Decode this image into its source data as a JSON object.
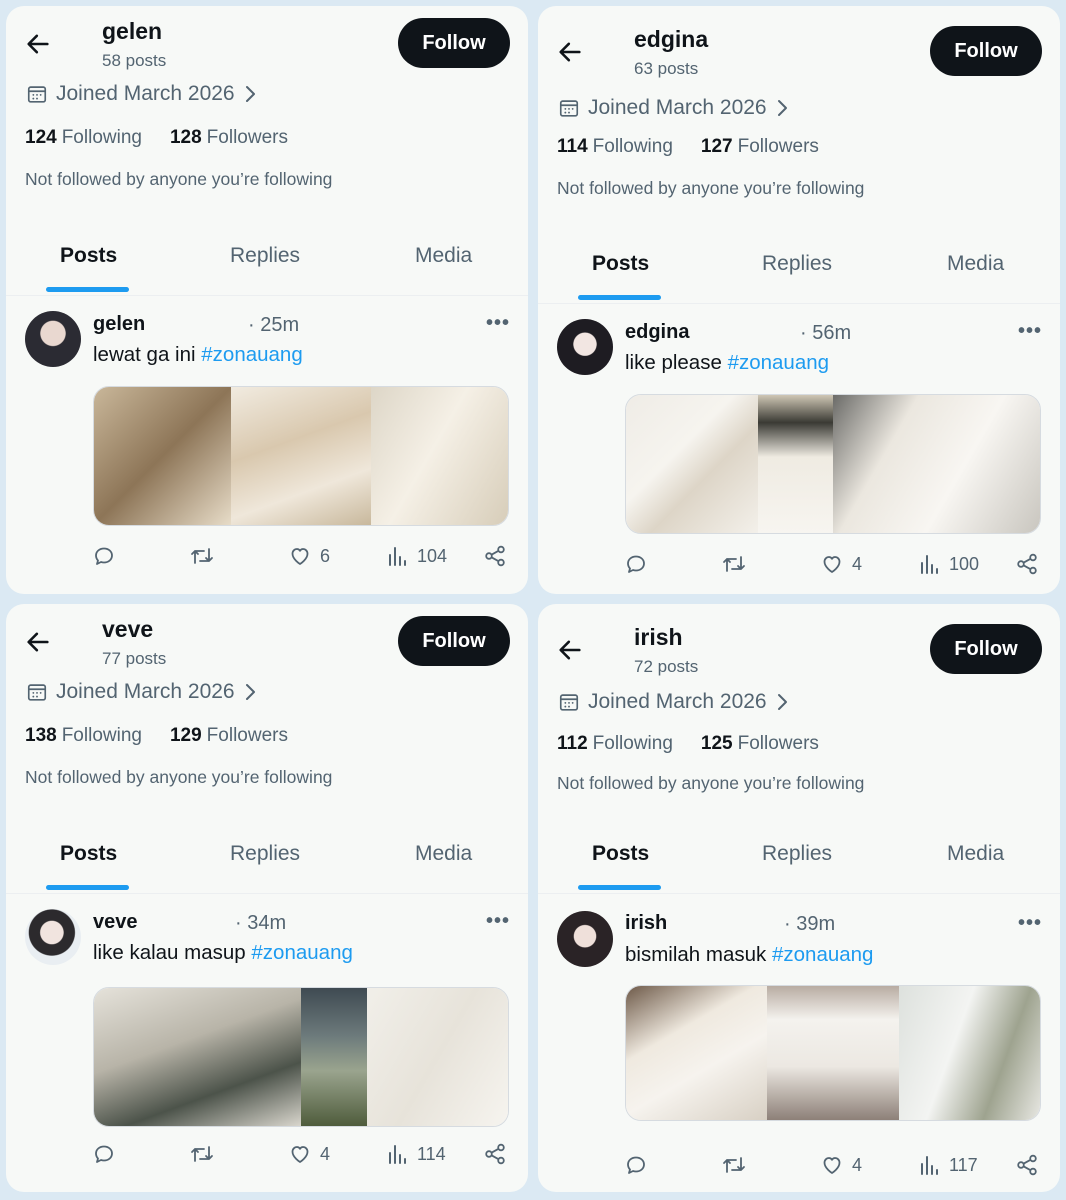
{
  "profiles": [
    {
      "name": "gelen",
      "posts_count": "58 posts",
      "follow_label": "Follow",
      "joined": "Joined March 2026",
      "following_count": "124",
      "following_label": "Following",
      "followers_count": "128",
      "followers_label": "Followers",
      "not_followed": "Not followed by anyone you’re following",
      "tabs": [
        "Posts",
        "Replies",
        "Media"
      ],
      "post": {
        "name": "gelen",
        "time": "· 25m",
        "text": "lewat ga ini",
        "hashtag": "#zonauang",
        "likes": "6",
        "views": "104"
      }
    },
    {
      "name": "edgina",
      "posts_count": "63 posts",
      "follow_label": "Follow",
      "joined": "Joined March 2026",
      "following_count": "114",
      "following_label": "Following",
      "followers_count": "127",
      "followers_label": "Followers",
      "not_followed": "Not followed by anyone you’re following",
      "tabs": [
        "Posts",
        "Replies",
        "Media"
      ],
      "post": {
        "name": "edgina",
        "time": "· 56m",
        "text": "like please",
        "hashtag": "#zonauang",
        "likes": "4",
        "views": "100"
      }
    },
    {
      "name": "veve",
      "posts_count": "77 posts",
      "follow_label": "Follow",
      "joined": "Joined March 2026",
      "following_count": "138",
      "following_label": "Following",
      "followers_count": "129",
      "followers_label": "Followers",
      "not_followed": "Not followed by anyone you’re following",
      "tabs": [
        "Posts",
        "Replies",
        "Media"
      ],
      "post": {
        "name": "veve",
        "time": "· 34m",
        "text": "like kalau masup",
        "hashtag": "#zonauang",
        "likes": "4",
        "views": "114"
      }
    },
    {
      "name": "irish",
      "posts_count": "72 posts",
      "follow_label": "Follow",
      "joined": "Joined March 2026",
      "following_count": "112",
      "following_label": "Following",
      "followers_count": "125",
      "followers_label": "Followers",
      "not_followed": "Not followed by anyone you’re following",
      "tabs": [
        "Posts",
        "Replies",
        "Media"
      ],
      "post": {
        "name": "irish",
        "time": "· 39m",
        "text": "bismilah masuk",
        "hashtag": "#zonauang",
        "likes": "4",
        "views": "117"
      }
    }
  ],
  "colors": {
    "accent": "#1d9bf0",
    "text": "#0f1419",
    "muted": "#536471",
    "button": "#0f1419",
    "panel": "#f7f9f7",
    "background": "#dbe9f3"
  },
  "icons": [
    "back-arrow-icon",
    "calendar-icon",
    "chevron-right-icon",
    "more-icon",
    "reply-icon",
    "retweet-icon",
    "like-icon",
    "views-icon",
    "share-icon"
  ]
}
